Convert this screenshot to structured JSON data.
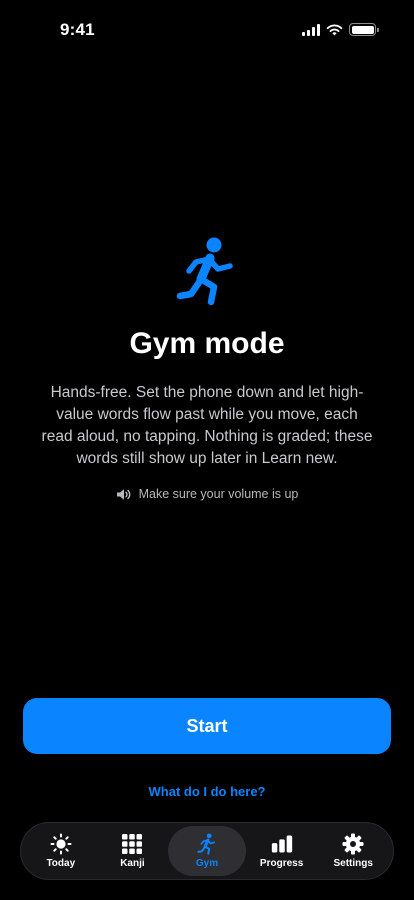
{
  "status_bar": {
    "time": "9:41"
  },
  "hero": {
    "icon": "running-figure-icon",
    "title": "Gym mode",
    "description": "Hands-free. Set the phone down and let high-value words flow past while you move, each read aloud, no tapping. Nothing is graded; these words still show up later in Learn new.",
    "volume_hint": "Make sure your volume is up"
  },
  "actions": {
    "start_label": "Start",
    "help_label": "What do I do here?"
  },
  "tab_bar": {
    "items": [
      {
        "label": "Today",
        "icon": "sun-icon"
      },
      {
        "label": "Kanji",
        "icon": "grid-icon"
      },
      {
        "label": "Gym",
        "icon": "running-figure-icon",
        "active": true
      },
      {
        "label": "Progress",
        "icon": "bar-chart-icon"
      },
      {
        "label": "Settings",
        "icon": "gear-icon"
      }
    ]
  },
  "colors": {
    "accent": "#0a84ff",
    "background": "#000000",
    "tab_bar": "#161618"
  }
}
